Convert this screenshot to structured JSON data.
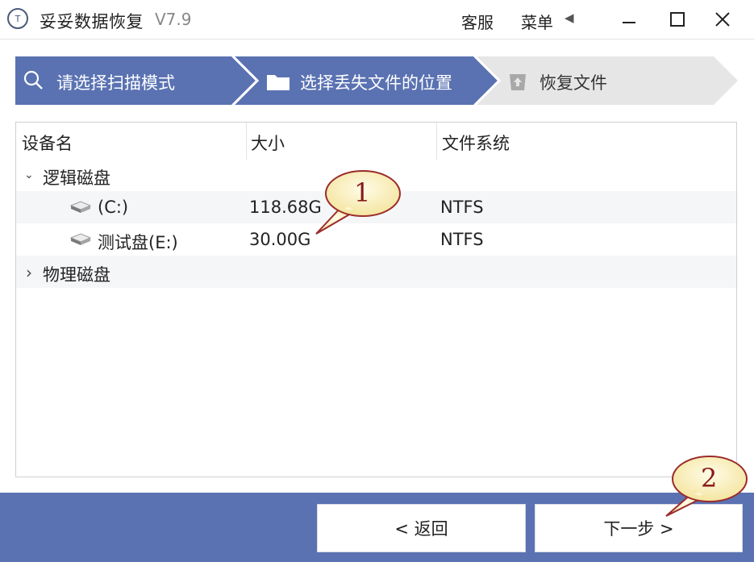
{
  "titlebar": {
    "logo_text": "T",
    "app_name": "妥妥数据恢复",
    "version": "V7.9",
    "service": "客服",
    "menu": "菜单",
    "menu_caret": "◀"
  },
  "steps": [
    {
      "label": "请选择扫描模式",
      "icon": "search-icon",
      "state": "done"
    },
    {
      "label": "选择丢失文件的位置",
      "icon": "folder-icon",
      "state": "active"
    },
    {
      "label": "恢复文件",
      "icon": "upload-icon",
      "state": "pending"
    }
  ],
  "colors": {
    "step_active": "#5a72b2",
    "step_pending": "#e6e6e6",
    "bottom_bar": "#5a72b2",
    "callout_fill": "#fdf4c8",
    "callout_stroke": "#9b2b2b"
  },
  "table": {
    "headers": {
      "name": "设备名",
      "size": "大小",
      "fs": "文件系统"
    },
    "groups": [
      {
        "label": "逻辑磁盘",
        "expander": "⌄",
        "items": [
          {
            "name": "(C:)",
            "size": "118.68G",
            "fs": "NTFS"
          },
          {
            "name": "测试盘(E:)",
            "size": "30.00G",
            "fs": "NTFS"
          }
        ]
      },
      {
        "label": "物理磁盘",
        "expander": "›",
        "items": []
      }
    ]
  },
  "buttons": {
    "back": "< 返回",
    "next": "下一步 >"
  },
  "callouts": [
    "1",
    "2"
  ]
}
